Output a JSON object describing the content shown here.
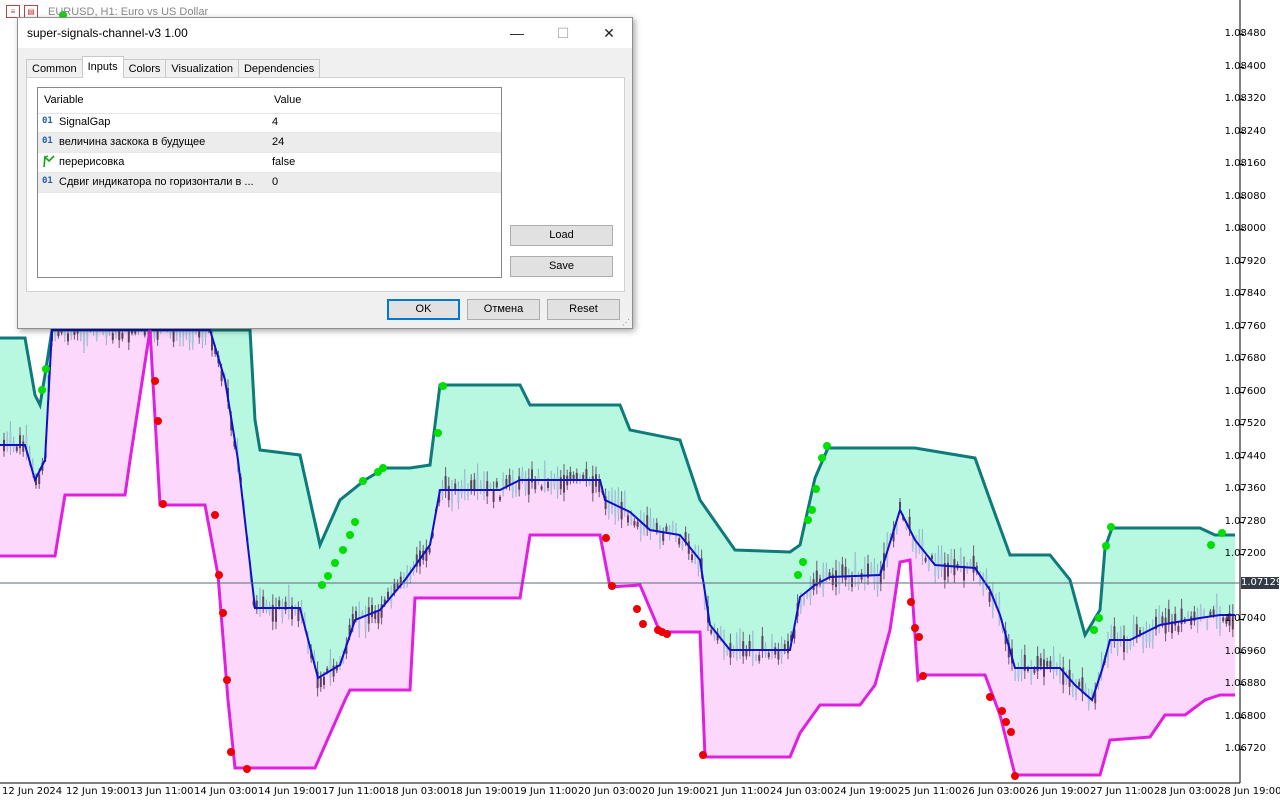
{
  "chart": {
    "title": "EURUSD, H1: Euro vs US Dollar",
    "current_price": "1.07129",
    "price_labels": [
      "1.08480",
      "1.08400",
      "1.08320",
      "1.08240",
      "1.08160",
      "1.08080",
      "1.08000",
      "1.07920",
      "1.07840",
      "1.07760",
      "1.07680",
      "1.07600",
      "1.07520",
      "1.07440",
      "1.07360",
      "1.07280",
      "1.07200",
      "1.07040",
      "1.06960",
      "1.06880",
      "1.06800",
      "1.06720"
    ],
    "date_labels": [
      "12 Jun 2024",
      "12 Jun 19:00",
      "13 Jun 11:00",
      "14 Jun 03:00",
      "14 Jun 19:00",
      "17 Jun 11:00",
      "18 Jun 03:00",
      "18 Jun 19:00",
      "19 Jun 11:00",
      "20 Jun 03:00",
      "20 Jun 19:00",
      "21 Jun 11:00",
      "24 Jun 03:00",
      "24 Jun 19:00",
      "25 Jun 11:00",
      "26 Jun 03:00",
      "26 Jun 19:00",
      "27 Jun 11:00",
      "28 Jun 03:00",
      "28 Jun 19:00"
    ],
    "colors": {
      "upper_line": "#0f7a7a",
      "mid_line": "#1010c8",
      "lower_line": "#e020e0",
      "upper_fill": "#b8f7e0",
      "lower_fill": "#fcd8fc",
      "buy_dot": "#00e000",
      "sell_dot": "#ee0000"
    }
  },
  "dialog": {
    "title": "super-signals-channel-v3 1.00",
    "tabs": [
      "Common",
      "Inputs",
      "Colors",
      "Visualization",
      "Dependencies"
    ],
    "active_tab": "Inputs",
    "columns": {
      "variable": "Variable",
      "value": "Value"
    },
    "rows": [
      {
        "type": "int",
        "icon": "01",
        "name": "SignalGap",
        "value": "4"
      },
      {
        "type": "int",
        "icon": "01",
        "name": "величина заскока в будущее",
        "value": "24"
      },
      {
        "type": "bool",
        "icon": "bool-icon",
        "name": "перерисовка",
        "value": "false"
      },
      {
        "type": "int",
        "icon": "01",
        "name": "Сдвиг индикатора по горизонтали в ...",
        "value": "0"
      }
    ],
    "side_buttons": {
      "load": "Load",
      "save": "Save"
    },
    "buttons": {
      "ok": "OK",
      "cancel": "Отмена",
      "reset": "Reset"
    },
    "window_controls": {
      "minimize": "—",
      "maximize": "☐",
      "close": "✕"
    }
  }
}
